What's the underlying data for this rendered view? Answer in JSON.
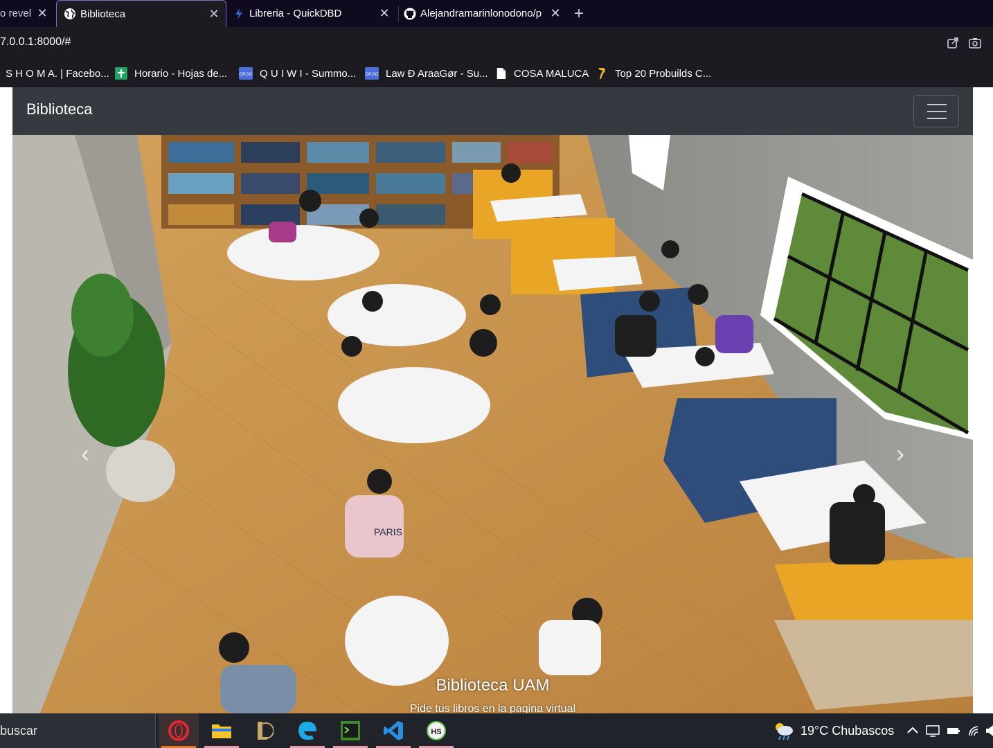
{
  "browser": {
    "tabs": [
      {
        "title": "o revel",
        "active": false
      },
      {
        "title": "Biblioteca",
        "active": true
      },
      {
        "title": "Libreria - QuickDBD",
        "active": false
      },
      {
        "title": "Alejandramarinlonodono/p",
        "active": false
      }
    ],
    "new_tab_label": "+",
    "url": "7.0.0.1:8000/#",
    "bookmarks": [
      {
        "label": "S H O M A. | Facebo...",
        "icon": "none"
      },
      {
        "label": "Horario - Hojas de...",
        "icon": "sheets-icon"
      },
      {
        "label": "Q U I W I - Summo...",
        "icon": "op-gg-icon"
      },
      {
        "label": "Law Ð AraaGør - Su...",
        "icon": "op-gg-icon"
      },
      {
        "label": "COSA MALUCA",
        "icon": "document-icon"
      },
      {
        "label": "Top 20 Probuilds C...",
        "icon": "probuilds-icon"
      }
    ]
  },
  "page": {
    "brand": "Biblioteca",
    "carousel": {
      "caption_title": "Biblioteca UAM",
      "caption_text": "Pide tus libros en la pagina virtual",
      "prev_label": "‹",
      "next_label": "›",
      "image_text": {
        "shirt": "PARIS"
      }
    }
  },
  "taskbar": {
    "search_placeholder": "buscar",
    "weather_text": "19°C  Chubascos",
    "apps": [
      "opera",
      "file-explorer",
      "league-of-legends",
      "edge",
      "terminal",
      "vs-code",
      "hs"
    ]
  }
}
